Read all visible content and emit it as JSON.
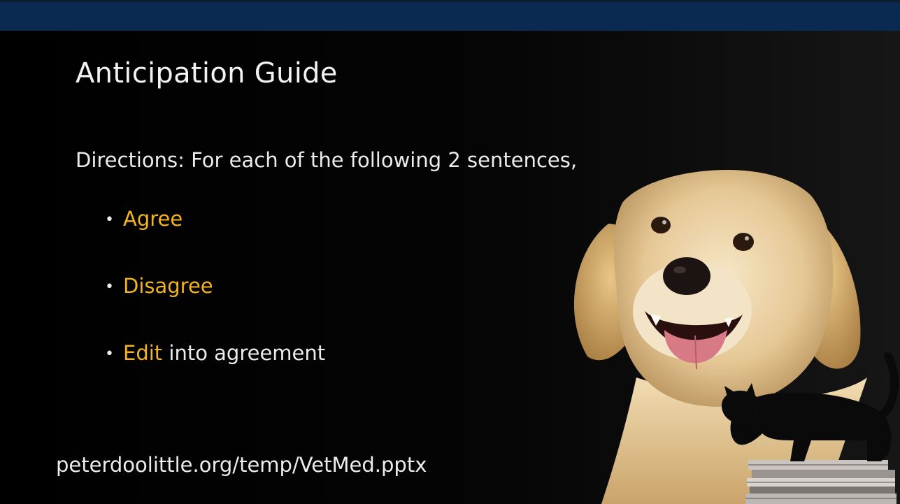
{
  "slide": {
    "title": "Anticipation Guide",
    "directions": "Directions: For each of the following 2 sentences,",
    "bullets": [
      {
        "highlight": "Agree",
        "rest": ""
      },
      {
        "highlight": "Disagree",
        "rest": ""
      },
      {
        "highlight": "Edit",
        "rest": " into agreement"
      }
    ],
    "url": "peterdoolittle.org/temp/VetMed.pptx"
  },
  "colors": {
    "band": "#0b2a52",
    "highlight": "#f2b41a",
    "text": "#ececec",
    "background": "#000000"
  },
  "images": [
    {
      "name": "golden-retriever-photo"
    },
    {
      "name": "black-cat-photo"
    },
    {
      "name": "stack-of-magazines-photo"
    }
  ]
}
